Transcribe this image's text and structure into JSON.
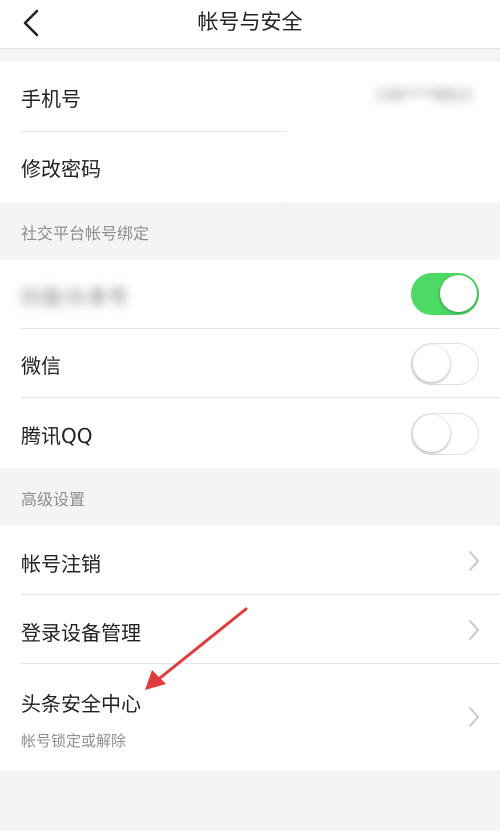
{
  "header": {
    "title": "帐号与安全"
  },
  "account": {
    "phone_label": "手机号",
    "phone_value": "138****8823",
    "password_label": "修改密码"
  },
  "social": {
    "section_label": "社交平台帐号绑定",
    "items": [
      {
        "label": "抖音/头条号",
        "on": true
      },
      {
        "label": "微信",
        "on": false
      },
      {
        "label": "腾讯QQ",
        "on": false
      }
    ]
  },
  "advanced": {
    "section_label": "高级设置",
    "items": [
      {
        "label": "帐号注销"
      },
      {
        "label": "登录设备管理"
      },
      {
        "label": "头条安全中心",
        "sublabel": "帐号锁定或解除"
      }
    ]
  },
  "colors": {
    "toggle_on": "#4cd964",
    "annotation_arrow": "#e03c3c"
  },
  "icons": {
    "back": "back-arrow-icon",
    "chevron": "chevron-right-icon"
  }
}
